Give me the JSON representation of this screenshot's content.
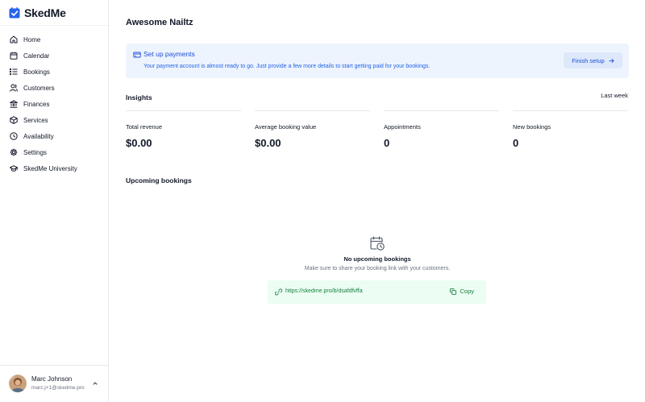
{
  "brand": {
    "name": "SkedMe",
    "logo_icon": "calendar-check-icon",
    "accent": "#2563eb"
  },
  "sidebar": {
    "items": [
      {
        "label": "Home",
        "icon": "home-icon"
      },
      {
        "label": "Calendar",
        "icon": "calendar-icon"
      },
      {
        "label": "Bookings",
        "icon": "list-icon"
      },
      {
        "label": "Customers",
        "icon": "users-icon"
      },
      {
        "label": "Finances",
        "icon": "bank-icon"
      },
      {
        "label": "Services",
        "icon": "box-icon"
      },
      {
        "label": "Availability",
        "icon": "clock-icon"
      },
      {
        "label": "Settings",
        "icon": "gear-icon"
      },
      {
        "label": "SkedMe University",
        "icon": "graduation-cap-icon"
      }
    ]
  },
  "user": {
    "name": "Marc Johnson",
    "email": "marc.j+1@skedme.pro"
  },
  "page": {
    "title": "Awesome Nailtz"
  },
  "banner": {
    "title": "Set up payments",
    "description": "Your payment account is almost ready to go. Just provide a few more details to start getting paid for your bookings.",
    "button_label": "Finish setup",
    "background": "#eef4fd",
    "text_color": "#1d4ed8"
  },
  "insights": {
    "title": "Insights",
    "period": "Last week",
    "stats": [
      {
        "label": "Total revenue",
        "value": "$0.00"
      },
      {
        "label": "Average booking value",
        "value": "$0.00"
      },
      {
        "label": "Appointments",
        "value": "0"
      },
      {
        "label": "New bookings",
        "value": "0"
      }
    ]
  },
  "upcoming": {
    "title": "Upcoming bookings",
    "empty_title": "No upcoming bookings",
    "empty_description": "Make sure to share your booking link with your customers.",
    "link": "https://skedme.pro/b/dsafdfvffa",
    "copy_label": "Copy",
    "link_background": "#ecfdf3",
    "link_color": "#15803d"
  }
}
